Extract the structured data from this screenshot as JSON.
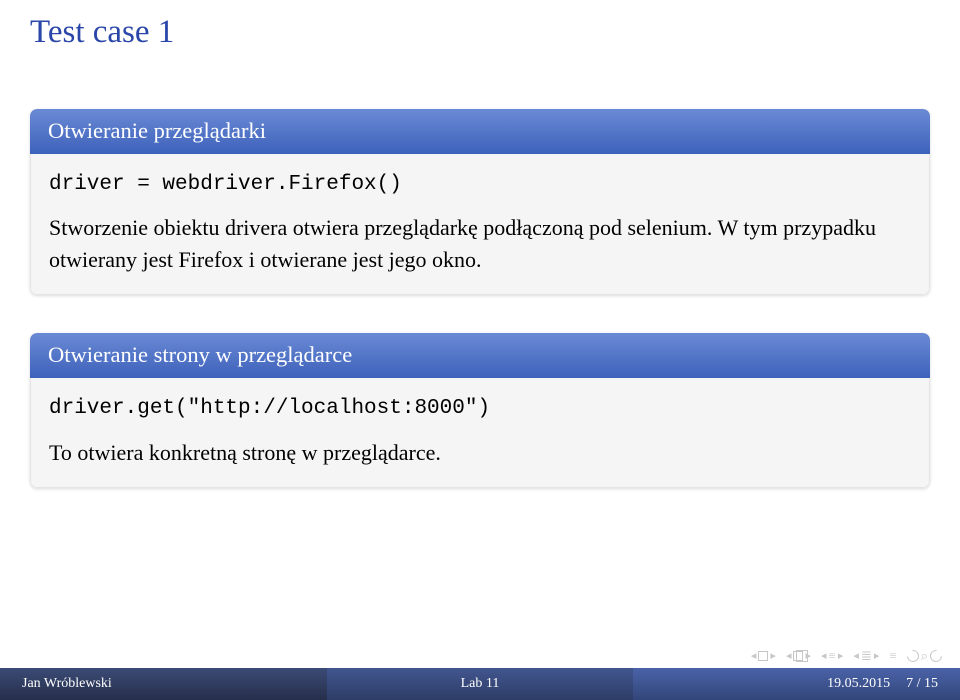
{
  "frametitle": "Test case 1",
  "block1": {
    "title": "Otwieranie przeglądarki",
    "code": "driver = webdriver.Firefox()",
    "body": "Stworzenie obiektu drivera otwiera przeglądarkę podłączoną pod selenium. W tym przypadku otwierany jest Firefox i otwierane jest jego okno."
  },
  "block2": {
    "title": "Otwieranie strony w przeglądarce",
    "code": "driver.get(\"http://localhost:8000\")",
    "body": "To otwiera konkretną stronę w przeglądarce."
  },
  "footline": {
    "author": "Jan Wróblewski",
    "title": "Lab 11",
    "date": "19.05.2015",
    "page": "7 / 15"
  }
}
